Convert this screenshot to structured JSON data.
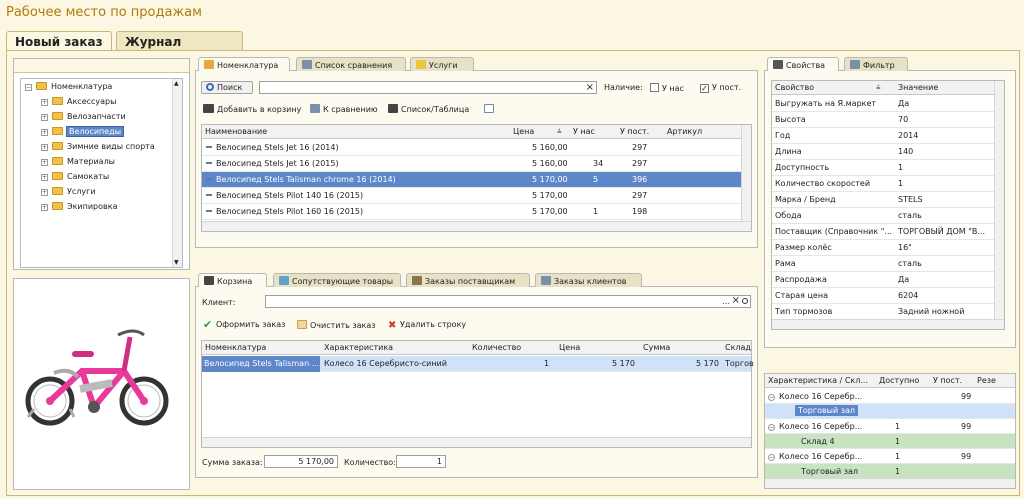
{
  "app_title": "Рабочее место по продажам",
  "main_tabs": [
    {
      "label": "Новый заказ"
    },
    {
      "label": "Журнал заказов"
    }
  ],
  "tree": {
    "root": "Номенклатура",
    "items": [
      "Аксессуары",
      "Велозапчасти",
      "Велосипеды",
      "Зимние виды спорта",
      "Материалы",
      "Самокаты",
      "Услуги",
      "Экипировка"
    ],
    "selected": "Велосипеды"
  },
  "top_tabs": [
    {
      "label": "Номенклатура"
    },
    {
      "label": "Список сравнения"
    },
    {
      "label": "Услуги"
    }
  ],
  "search": {
    "button": "Поиск",
    "value": "",
    "clear": "×"
  },
  "availability": {
    "label": "Наличие:",
    "opt1": "У нас",
    "opt2": "У пост.",
    "opt2_checked": "✓"
  },
  "toolbar": {
    "add_to_cart": "Добавить в корзину",
    "compare": "К сравнению",
    "list_table": "Список/Таблица"
  },
  "products": {
    "headers": {
      "name": "Наименование",
      "price": "Цена",
      "ours": "У нас",
      "supplier": "У пост.",
      "article": "Артикул"
    },
    "rows": [
      {
        "name": "Велосипед Stels Jet 16 (2014)",
        "price": "5 160,00",
        "ours": "",
        "supplier": "297"
      },
      {
        "name": "Велосипед Stels Jet 16 (2015)",
        "price": "5 160,00",
        "ours": "34",
        "supplier": "297"
      },
      {
        "name": "Велосипед Stels Talisman chrome 16 (2014)",
        "price": "5 170,00",
        "ours": "5",
        "supplier": "396"
      },
      {
        "name": "Велосипед Stels Pilot 140 16 (2015)",
        "price": "5 170,00",
        "ours": "",
        "supplier": "297"
      },
      {
        "name": "Велосипед Stels Pilot 160 16 (2015)",
        "price": "5 170,00",
        "ours": "1",
        "supplier": "198"
      }
    ]
  },
  "bottom_tabs": [
    {
      "label": "Корзина"
    },
    {
      "label": "Сопутствующие товары"
    },
    {
      "label": "Заказы поставщикам"
    },
    {
      "label": "Заказы клиентов"
    }
  ],
  "client": {
    "label": "Клиент:",
    "value": "",
    "btn_more": "...",
    "btn_clear": "×"
  },
  "cart_toolbar": {
    "checkout": "Оформить заказ",
    "clear": "Очистить заказ",
    "delete_row": "Удалить строку"
  },
  "cart": {
    "headers": {
      "item": "Номенклатура",
      "char": "Характеристика",
      "qty": "Количество",
      "price": "Цена",
      "sum": "Сумма",
      "warehouse": "Склад"
    },
    "rows": [
      {
        "item": "Велосипед Stels Talisman ...",
        "char": "Колесо 16 Серебристо-синий",
        "qty": "1",
        "price": "5 170",
        "sum": "5 170",
        "warehouse": "Торгов"
      }
    ]
  },
  "summary": {
    "sum_label": "Сумма заказа:",
    "sum_value": "5 170,00",
    "qty_label": "Количество:",
    "qty_value": "1"
  },
  "right_tabs": [
    {
      "label": "Свойства"
    },
    {
      "label": "Фильтр"
    }
  ],
  "properties": {
    "headers": {
      "prop": "Свойство",
      "value": "Значение"
    },
    "rows": [
      {
        "prop": "Выгружать на Я.маркет",
        "value": "Да"
      },
      {
        "prop": "Высота",
        "value": "70"
      },
      {
        "prop": "Год",
        "value": "2014"
      },
      {
        "prop": "Длина",
        "value": "140"
      },
      {
        "prop": "Доступность",
        "value": "1"
      },
      {
        "prop": "Количество скоростей",
        "value": "1"
      },
      {
        "prop": "Марка / Бренд",
        "value": "STELS"
      },
      {
        "prop": "Обода",
        "value": "сталь"
      },
      {
        "prop": "Поставщик (Справочник \"...",
        "value": "ТОРГОВЫЙ ДОМ \"В..."
      },
      {
        "prop": "Размер колёс",
        "value": "16\""
      },
      {
        "prop": "Рама",
        "value": "сталь"
      },
      {
        "prop": "Распродажа",
        "value": "Да"
      },
      {
        "prop": "Старая цена",
        "value": "6204"
      },
      {
        "prop": "Тип тормозов",
        "value": "Задний ножной"
      }
    ]
  },
  "stock": {
    "headers": {
      "char": "Характеристика / Скл...",
      "avail": "Доступно",
      "supp": "У пост.",
      "res": "Резе"
    },
    "rows": [
      {
        "char": "Колесо 16 Серебр...",
        "avail": "",
        "supp": "99",
        "kind": "group"
      },
      {
        "char": "Торговый зал",
        "avail": "",
        "supp": "",
        "kind": "sub-sel"
      },
      {
        "char": "Колесо 16 Серебр...",
        "avail": "1",
        "supp": "99",
        "kind": "group"
      },
      {
        "char": "Склад 4",
        "avail": "1",
        "supp": "",
        "kind": "sub"
      },
      {
        "char": "Колесо 16 Серебр...",
        "avail": "1",
        "supp": "99",
        "kind": "group"
      },
      {
        "char": "Торговый зал",
        "avail": "1",
        "supp": "",
        "kind": "sub"
      }
    ]
  }
}
